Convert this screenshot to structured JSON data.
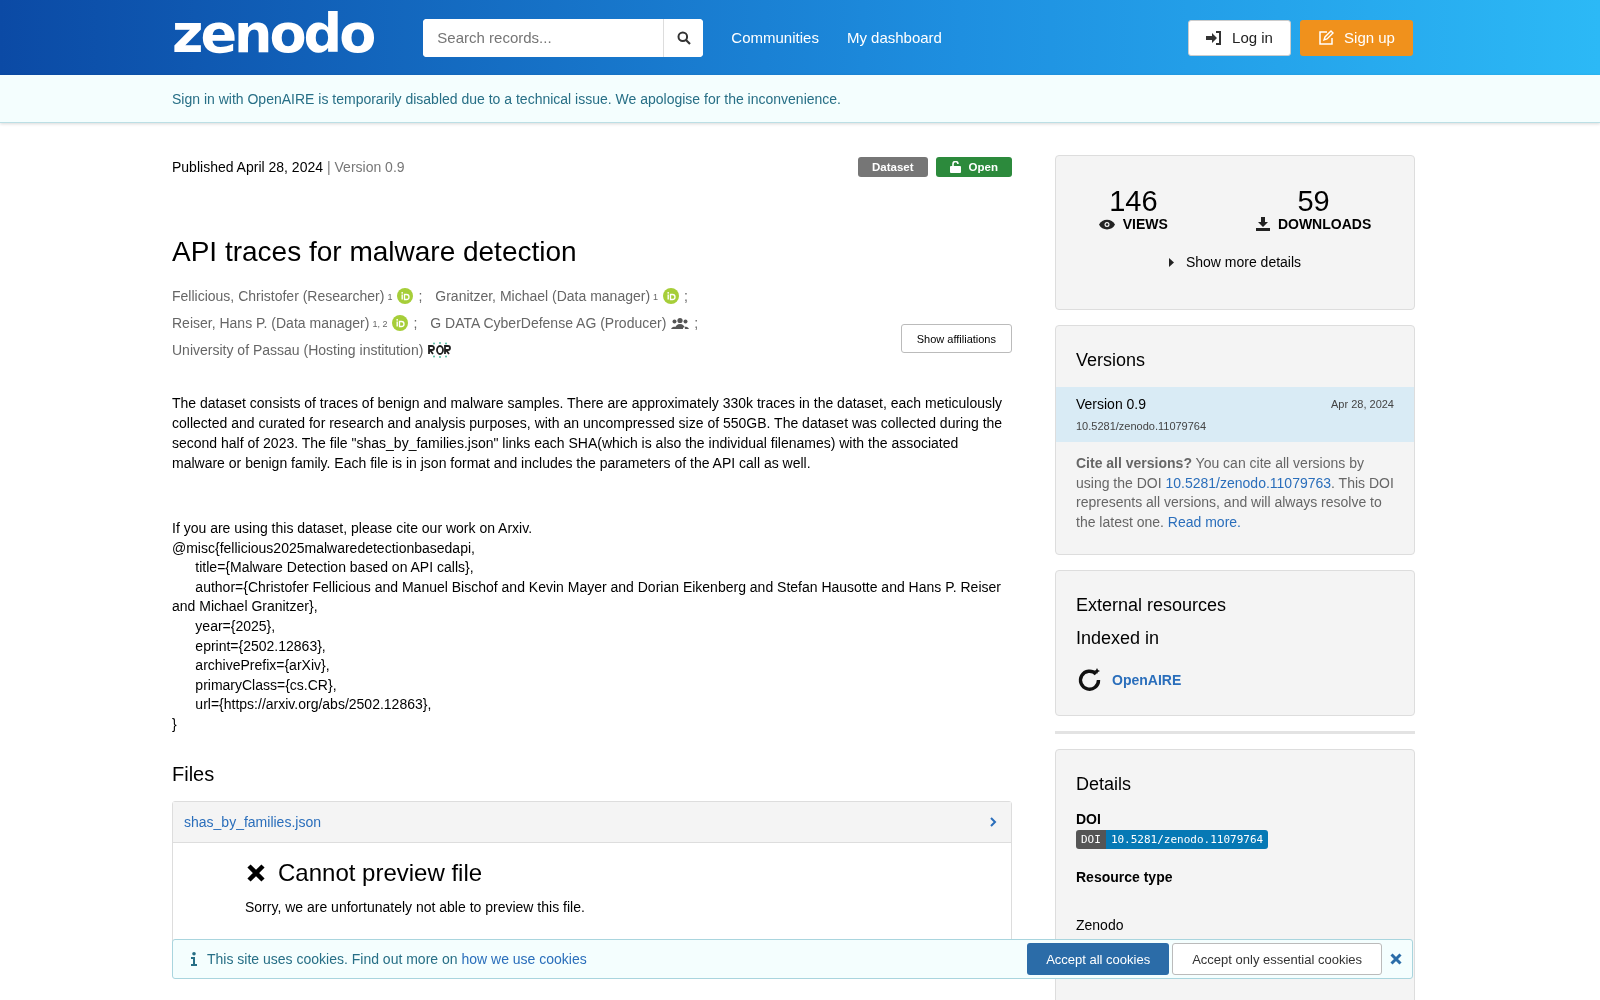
{
  "header": {
    "logo": "zenodo",
    "search": {
      "placeholder": "Search records..."
    },
    "nav": [
      "Communities",
      "My dashboard"
    ],
    "login": "Log in",
    "signup": "Sign up"
  },
  "notice": "Sign in with OpenAIRE is temporarily disabled due to a technical issue. We apologise for the inconvenience.",
  "record": {
    "published": "Published April 28, 2024",
    "version": "| Version 0.9",
    "badges": [
      {
        "kind": "type",
        "label": "Dataset"
      },
      {
        "kind": "access",
        "label": "Open"
      }
    ],
    "title": "API traces for malware detection",
    "creator_lines": [
      [
        {
          "name": "Fellicious, Christofer (Researcher)",
          "sup": "1",
          "kind": "orcid",
          "separator": ";"
        },
        {
          "name": "Granitzer, Michael (Data manager)",
          "sup": "1",
          "kind": "orcid",
          "separator": ";"
        }
      ],
      [
        {
          "name": "Reiser, Hans P. (Data manager)",
          "sup": "1, 2",
          "kind": "orcid",
          "separator": ";"
        },
        {
          "name": "G DATA CyberDefense AG (Producer)",
          "kind": "group",
          "separator": ";"
        }
      ],
      [
        {
          "name": "University of Passau (Hosting institution)",
          "kind": "ror"
        }
      ]
    ],
    "show_affiliations": "Show affiliations",
    "description": "The dataset consists of traces of benign and malware samples. There are approximately 330k traces in the dataset, each meticulously collected and curated for research and analysis purposes, with an uncompressed size of 550GB. The dataset was collected during the second half of 2023. The file \"shas_by_families.json\" links each SHA(which is also the individual filenames) with the associated malware or benign family.  Each file is in json format and includes the parameters of the API call as well.",
    "citation": "If you are using this dataset, please cite our work on Arxiv.\n@misc{fellicious2025malwaredetectionbasedapi,\n      title={Malware Detection based on API calls},\n      author={Christofer Fellicious and Manuel Bischof and Kevin Mayer and Dorian Eikenberg and Stefan Hausotte and Hans P. Reiser and Michael Granitzer},\n      year={2025},\n      eprint={2502.12863},\n      archivePrefix={arXiv},\n      primaryClass={cs.CR},\n      url={https://arxiv.org/abs/2502.12863},\n}",
    "files": {
      "heading": "Files",
      "file": "shas_by_families.json",
      "preview_title": "Cannot preview file",
      "preview_text": "Sorry, we are unfortunately not able to preview this file."
    }
  },
  "sidebar": {
    "stats": [
      {
        "kind": "views",
        "value": "146",
        "label": "VIEWS"
      },
      {
        "kind": "downloads",
        "value": "59",
        "label": "DOWNLOADS"
      }
    ],
    "show_more": "Show more details",
    "versions": {
      "heading": "Versions",
      "items": [
        {
          "label": "Version 0.9",
          "date": "Apr 28, 2024",
          "doi": "10.5281/zenodo.11079764",
          "selected": true
        }
      ],
      "cite_bold": "Cite all versions?",
      "cite_text_1": " You can cite all versions by using the DOI ",
      "cite_link": "10.5281/zenodo.11079763",
      "cite_text_2": ". This DOI represents all versions, and will always resolve to the latest one. ",
      "read_more": "Read more."
    },
    "external": {
      "heading": "External resources",
      "subheading": "Indexed in",
      "link": "OpenAIRE"
    },
    "details": {
      "heading": "Details",
      "doi_label": "DOI",
      "doi_badge_left": "DOI",
      "doi_badge_right": "10.5281/zenodo.11079764",
      "resource_label": "Resource type",
      "publisher_value": "Zenodo"
    }
  },
  "cookies": {
    "text": "This site uses cookies. Find out more on ",
    "link": "how we use cookies",
    "accept_all": "Accept all cookies",
    "accept_essential": "Accept only essential cookies"
  }
}
